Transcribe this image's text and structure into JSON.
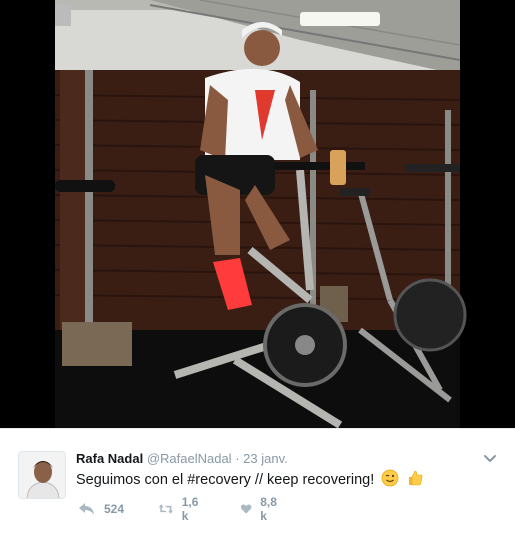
{
  "tweet": {
    "author_name": "Rafa Nadal",
    "author_handle": "@RafaelNadal",
    "separator": "·",
    "timestamp": "23 janv.",
    "text_before": "Seguimos con el ",
    "hashtag": "#recovery",
    "text_after": " // keep recovering!",
    "emoji": [
      "wink-face",
      "thumbs-up"
    ],
    "reply_count": "524",
    "retweet_count": "1,6 k",
    "like_count": "8,8 k"
  },
  "colors": {
    "muted": "#8899a6",
    "text": "#14171a",
    "border": "#e6ecf0",
    "shoe_accent": "#ff3b3b"
  }
}
